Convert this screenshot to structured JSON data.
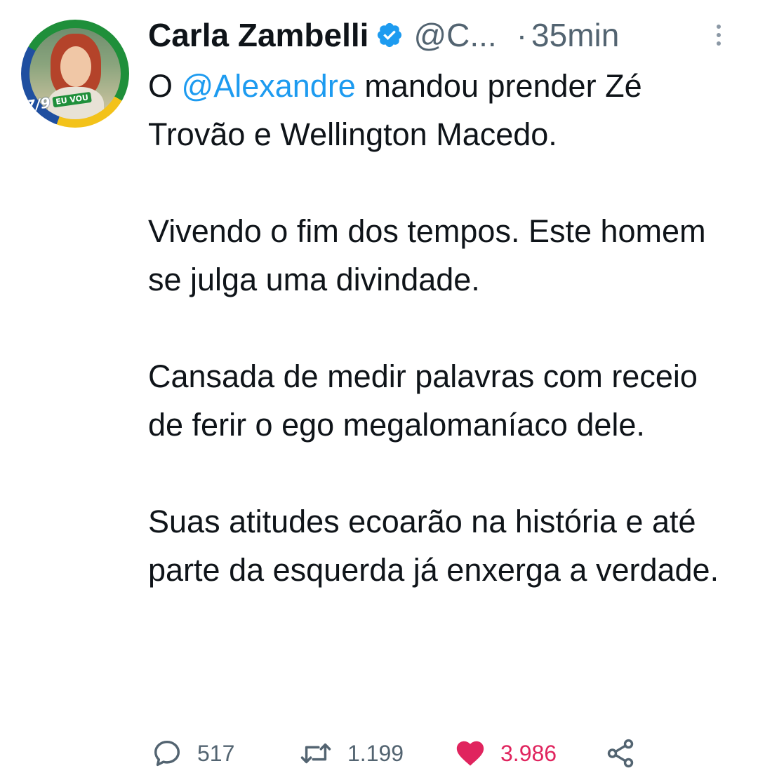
{
  "tweet": {
    "author": {
      "name": "Carla Zambelli",
      "handle": "@C...",
      "verified": true,
      "avatar_badge_number": "7/9",
      "avatar_badge_text": "EU VOU"
    },
    "separator": "·",
    "time": "35min",
    "body": {
      "p1_prefix": "O ",
      "p1_mention": "@Alexandre",
      "p1_suffix": " mandou prender Zé Trovão e Wellington Macedo.",
      "p2": "Vivendo o fim dos tempos. Este homem se julga uma divindade.",
      "p3": "Cansada de medir palavras com receio de ferir o ego megalomaníaco dele.",
      "p4": "Suas atitudes ecoarão na história e até parte da esquerda já enxerga a verdade."
    },
    "actions": {
      "replies": "517",
      "retweets": "1.199",
      "likes": "3.986",
      "liked": true
    },
    "icons": {
      "verified": "verified-badge-icon",
      "more": "more-options-icon",
      "reply": "reply-icon",
      "retweet": "retweet-icon",
      "like": "heart-icon",
      "share": "share-icon"
    }
  },
  "colors": {
    "mention": "#1d9bf0",
    "secondary_text": "#536471",
    "like_active": "#e0245e",
    "verified": "#1d9bf0"
  }
}
